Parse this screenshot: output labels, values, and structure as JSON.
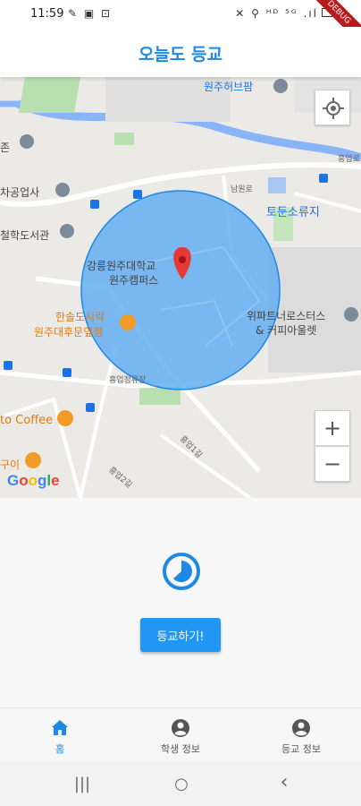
{
  "status_bar": {
    "time": "11:59",
    "left_icons": "✎ ▣ ⊡",
    "right_icons": "✕ ⚲ ᴴᴰ ⁵ᴳ .ıl",
    "debug_label": "DEBUG"
  },
  "app": {
    "title": "오늘도 등교"
  },
  "map": {
    "labels": {
      "park": "원주허브팜",
      "rest": "토둔소류지",
      "school": "강릉원주대학교",
      "campus": "원주캠퍼스",
      "library": "철학도서관",
      "industry": "차공업사",
      "zone": "존",
      "restaurant1": "한솔도시락",
      "restaurant1_b": "원주대후문앞점",
      "apartment1": "위파트너로스터스",
      "apartment2": "& 커피아울렛",
      "coffee": "to Coffee",
      "gui": "구이",
      "road1": "흥업1길",
      "road2": "흥업2길",
      "road3": "흥업로",
      "road4": "남원로",
      "road5": "흥업정류장"
    },
    "zoom_in": "+",
    "zoom_out": "−",
    "attribution": [
      "G",
      "o",
      "o",
      "g",
      "l",
      "e"
    ],
    "colors": {
      "circle_fill": "#64aef0",
      "circle_stroke": "#1e88e5",
      "marker": "#e53935"
    }
  },
  "checkin": {
    "button_label": "등교하기!",
    "icon": "timer-icon"
  },
  "bottom_nav": {
    "items": [
      {
        "label": "홈",
        "icon": "home-icon"
      },
      {
        "label": "학생 정보",
        "icon": "account-circle-icon"
      },
      {
        "label": "등교 정보",
        "icon": "account-circle-icon"
      }
    ]
  },
  "system_nav": {
    "recent": "|||",
    "home": "○",
    "back": "‹"
  },
  "colors": {
    "accent": "#1e88e5",
    "button": "#2196f3"
  }
}
